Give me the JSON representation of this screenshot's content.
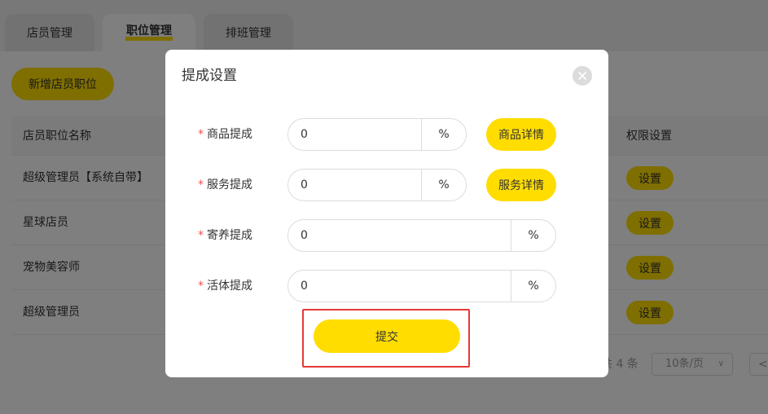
{
  "tabs": [
    {
      "label": "店员管理"
    },
    {
      "label": "职位管理"
    },
    {
      "label": "排班管理"
    }
  ],
  "toolbar": {
    "add_label": "新增店员职位"
  },
  "table": {
    "headers": {
      "name": "店员职位名称",
      "permission": "权限设置"
    },
    "rows": [
      {
        "name": "超级管理员【系统自带】",
        "action": "设置"
      },
      {
        "name": "星球店员",
        "action": "设置"
      },
      {
        "name": "宠物美容师",
        "action": "设置"
      },
      {
        "name": "超级管理员",
        "action": "设置"
      }
    ]
  },
  "pagination": {
    "total_text": "共 4 条",
    "page_size": "10条/页",
    "prev": "<"
  },
  "modal": {
    "title": "提成设置",
    "required_mark": "*",
    "fields": [
      {
        "label": "商品提成",
        "value": "0",
        "unit": "%",
        "detail_button": "商品详情"
      },
      {
        "label": "服务提成",
        "value": "0",
        "unit": "%",
        "detail_button": "服务详情"
      },
      {
        "label": "寄养提成",
        "value": "0",
        "unit": "%"
      },
      {
        "label": "活体提成",
        "value": "0",
        "unit": "%"
      }
    ],
    "submit_label": "提交"
  },
  "colors": {
    "accent": "#ffdd00",
    "highlight_border": "#e53935",
    "required": "#f05050"
  },
  "icons": {
    "close": "close-icon",
    "page_size_dropdown": "chevron-down-icon"
  }
}
